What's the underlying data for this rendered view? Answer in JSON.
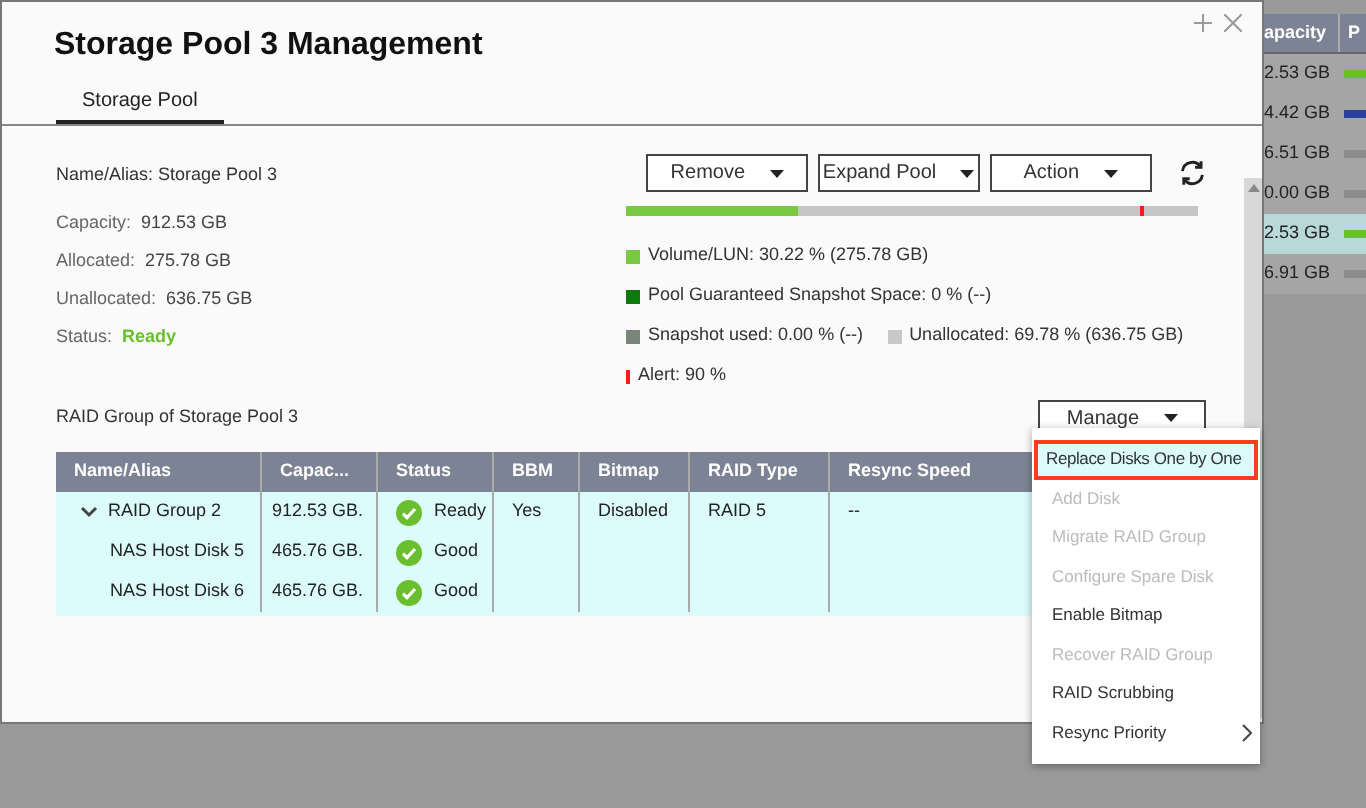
{
  "background_table": {
    "columns": [
      "apacity",
      "P"
    ],
    "rows": [
      {
        "capacity": "2.53 GB",
        "color": "#6abf2f",
        "selected": false
      },
      {
        "capacity": "4.42 GB",
        "color": "#2b3f9e",
        "selected": false
      },
      {
        "capacity": "6.51 GB",
        "color": "#8c8c8c",
        "selected": false
      },
      {
        "capacity": "0.00 GB",
        "color": "#8c8c8c",
        "selected": false
      },
      {
        "capacity": "2.53 GB",
        "color": "#6abf2f",
        "selected": true
      },
      {
        "capacity": "6.91 GB",
        "color": "#8c8c8c",
        "selected": false
      }
    ]
  },
  "window": {
    "title": "Storage Pool 3 Management"
  },
  "tabs": [
    {
      "label": "Storage Pool",
      "selected": true
    }
  ],
  "pool_info": {
    "name": "Name/Alias: Storage Pool 3",
    "fields": [
      {
        "label": "Capacity:",
        "value": "912.53 GB"
      },
      {
        "label": "Allocated:",
        "value": "275.78 GB"
      },
      {
        "label": "Unallocated:",
        "value": "636.75 GB"
      },
      {
        "label": "Status:",
        "value": "Ready",
        "kind": "status"
      }
    ]
  },
  "toolbar": [
    "Remove",
    "Expand Pool",
    "Action"
  ],
  "usage": {
    "level": 0.3022,
    "alert_marker": {
      "level": 0.9
    },
    "legend": [
      {
        "label": "Volume/LUN: 30.22 % (275.78 GB)",
        "color": "#7ac943"
      },
      {
        "label": "Pool Guaranteed Snapshot Space: 0 % (--)",
        "color": "#0e7a0e"
      },
      {
        "label": "Snapshot used: 0.00 % (--)",
        "color": "#7a857a"
      },
      {
        "label": "Unallocated: 69.78 % (636.75 GB)",
        "color": "#c8c8c8"
      },
      {
        "label": "Alert: 90 %",
        "color": "#ff1a1a"
      }
    ]
  },
  "raid_section": {
    "title": "RAID Group of Storage Pool 3",
    "manage_button": "Manage",
    "table": {
      "columns": [
        "Name/Alias",
        "Capac...",
        "Status",
        "BBM",
        "Bitmap",
        "RAID Type",
        "Resync Speed"
      ],
      "rows": [
        {
          "name": "RAID Group 2",
          "expanded": true,
          "capacity": "912.53 GB.",
          "status": "Ready",
          "bbm": "Yes",
          "bitmap": "Disabled",
          "raid_type": "RAID 5",
          "resync_speed": "--",
          "children": [
            {
              "name": "NAS Host Disk 5",
              "capacity": "465.76 GB.",
              "status": "Good"
            },
            {
              "name": "NAS Host Disk 6",
              "capacity": "465.76 GB.",
              "status": "Good"
            }
          ]
        }
      ]
    }
  },
  "manage_menu": [
    {
      "label": "Replace Disks One by One",
      "selected": true,
      "disabled": false,
      "submenu": false
    },
    {
      "label": "Add Disk",
      "selected": false,
      "disabled": true,
      "submenu": false
    },
    {
      "label": "Migrate RAID Group",
      "selected": false,
      "disabled": true,
      "submenu": false
    },
    {
      "label": "Configure Spare Disk",
      "selected": false,
      "disabled": true,
      "submenu": false
    },
    {
      "label": "Enable Bitmap",
      "selected": false,
      "disabled": false,
      "submenu": false
    },
    {
      "label": "Recover RAID Group",
      "selected": false,
      "disabled": true,
      "submenu": false
    },
    {
      "label": "RAID Scrubbing",
      "selected": false,
      "disabled": false,
      "submenu": false
    },
    {
      "label": "Resync Priority",
      "selected": false,
      "disabled": false,
      "submenu": true
    }
  ]
}
